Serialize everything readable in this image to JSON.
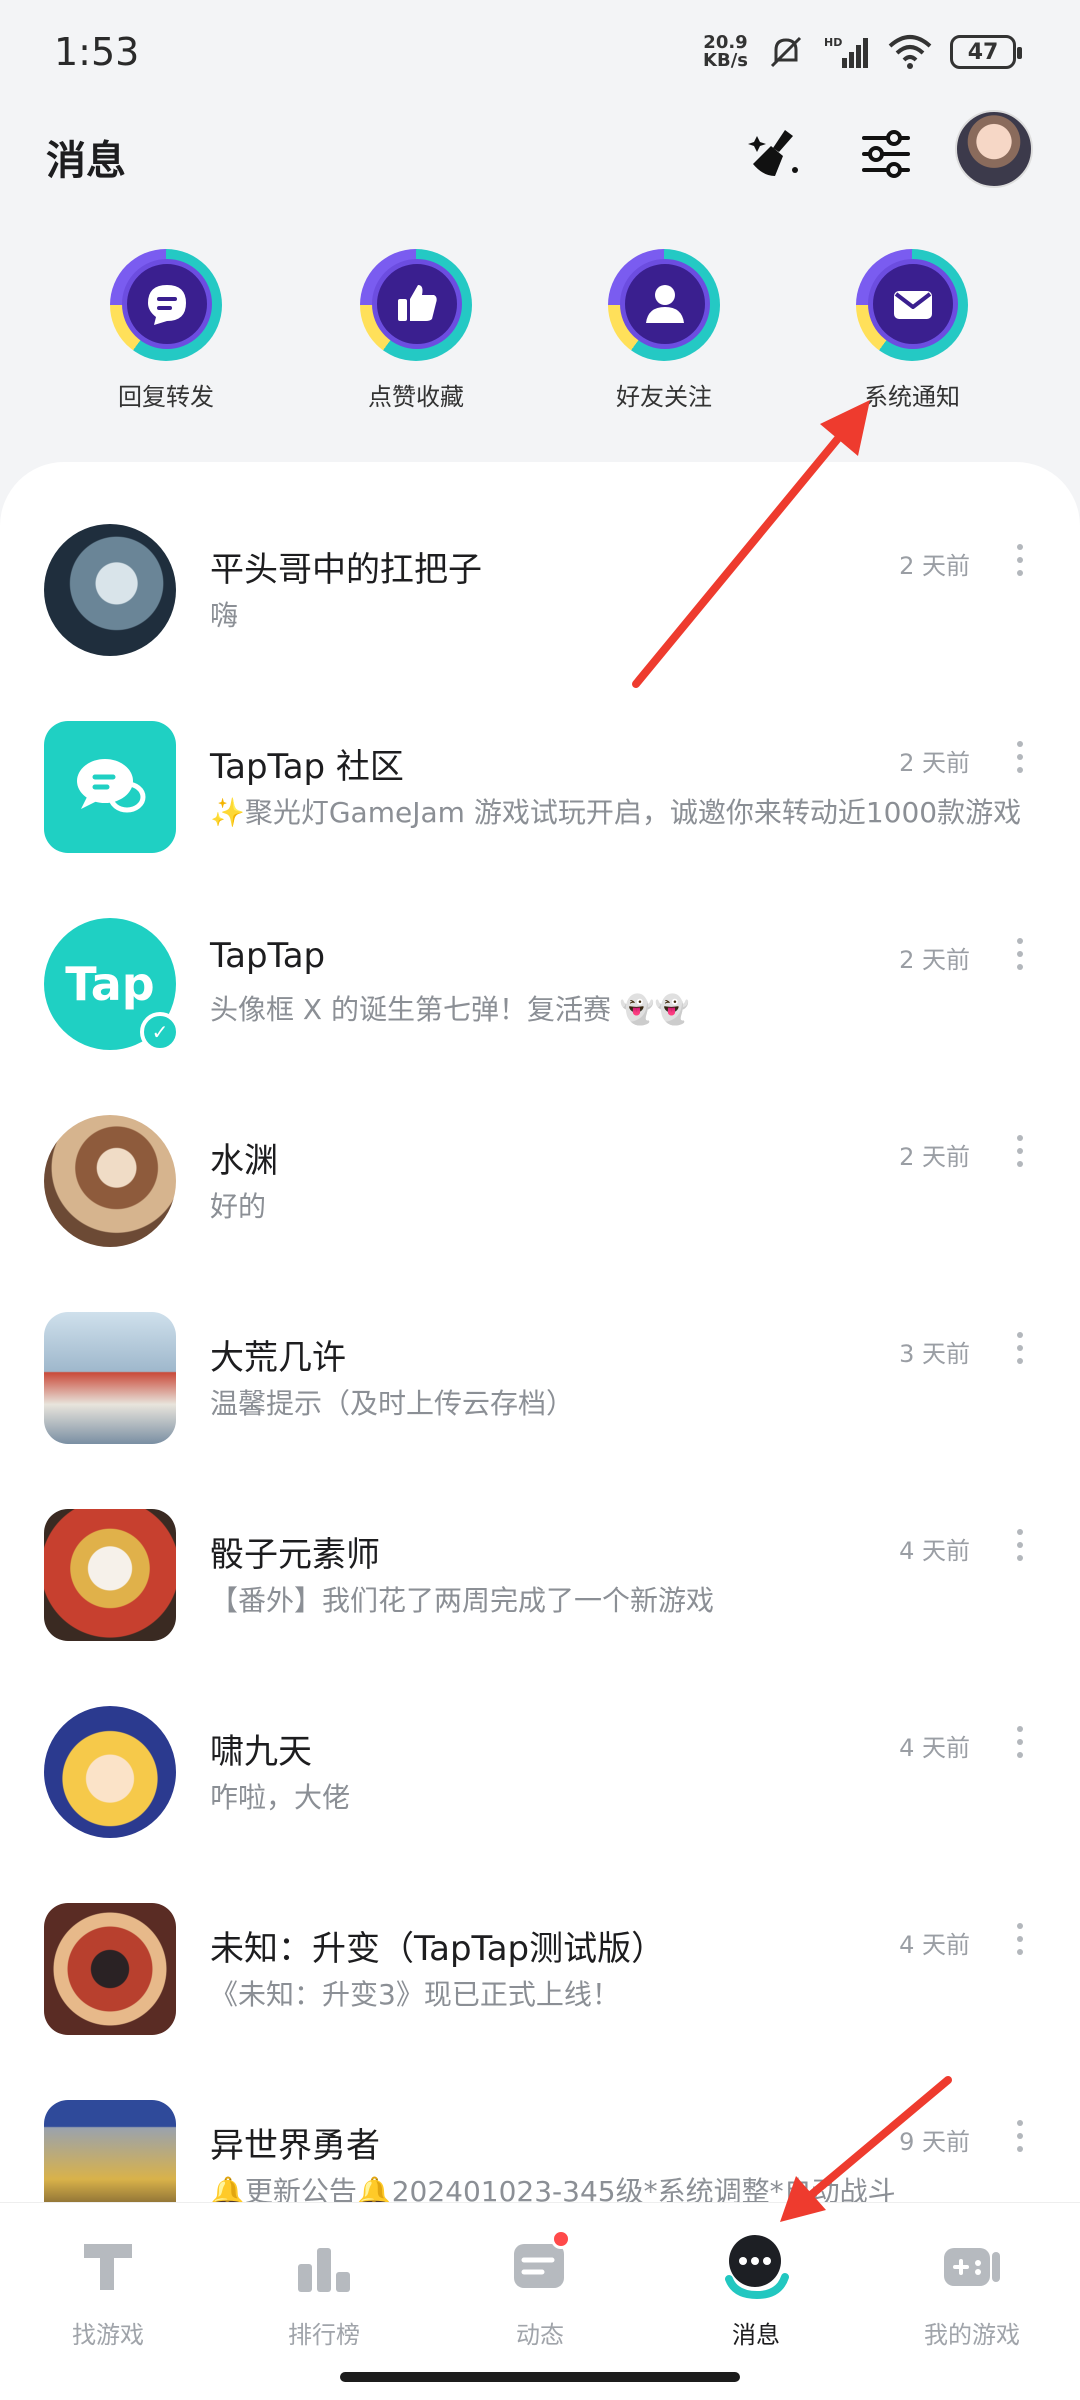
{
  "status_bar": {
    "time": "1:53",
    "net_speed_value": "20.9",
    "net_speed_unit": "KB/s",
    "battery": "47"
  },
  "header": {
    "title": "消息",
    "icons": [
      "broom-icon",
      "filter-settings-icon",
      "user-avatar"
    ]
  },
  "quick_actions": [
    {
      "label": "回复转发",
      "icon": "reply-chat-icon"
    },
    {
      "label": "点赞收藏",
      "icon": "thumbs-up-icon"
    },
    {
      "label": "好友关注",
      "icon": "person-icon"
    },
    {
      "label": "系统通知",
      "icon": "mail-icon"
    }
  ],
  "messages": [
    {
      "title": "平头哥中的扛把子",
      "preview": "嗨",
      "time": "2 天前"
    },
    {
      "title": "TapTap 社区",
      "preview": "✨聚光灯GameJam 游戏试玩开启，诚邀你来转动近1000款游戏",
      "time": "2 天前"
    },
    {
      "title": "TapTap",
      "preview": "头像框 X 的诞生第七弹！复活赛 👻👻",
      "time": "2 天前"
    },
    {
      "title": "水渊",
      "preview": "好的",
      "time": "2 天前"
    },
    {
      "title": "大荒几许",
      "preview": "温馨提示（及时上传云存档）",
      "time": "3 天前"
    },
    {
      "title": "骰子元素师",
      "preview": "【番外】我们花了两周完成了一个新游戏",
      "time": "4 天前"
    },
    {
      "title": "啸九天",
      "preview": "咋啦，大佬",
      "time": "4 天前"
    },
    {
      "title": "未知：升变（TapTap测试版）",
      "preview": "《未知：升变3》现已正式上线！",
      "time": "4 天前"
    },
    {
      "title": "异世界勇者",
      "preview": "🔔更新公告🔔202401023-345级*系统调整*自动战斗",
      "time": "9 天前"
    }
  ],
  "bottom_nav": [
    {
      "label": "找游戏",
      "icon": "find-game-icon",
      "active": false
    },
    {
      "label": "排行榜",
      "icon": "ranking-icon",
      "active": false
    },
    {
      "label": "动态",
      "icon": "feed-icon",
      "active": false,
      "badge": true
    },
    {
      "label": "消息",
      "icon": "message-icon",
      "active": true
    },
    {
      "label": "我的游戏",
      "icon": "my-games-icon",
      "active": false
    }
  ],
  "colors": {
    "accent_teal": "#22c7c0",
    "annotation_red": "#ee3b2e",
    "badge_red": "#ff4a4a"
  }
}
